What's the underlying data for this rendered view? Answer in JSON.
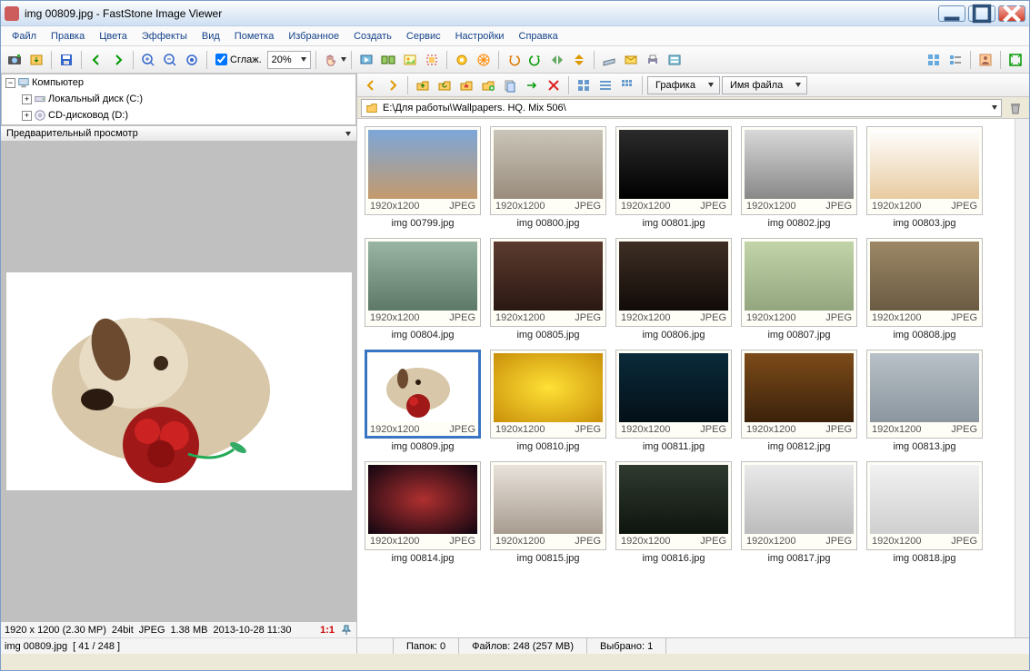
{
  "title": "img 00809.jpg  -  FastStone Image Viewer",
  "menu": [
    "Файл",
    "Правка",
    "Цвета",
    "Эффекты",
    "Вид",
    "Пометка",
    "Избранное",
    "Создать",
    "Сервис",
    "Настройки",
    "Справка"
  ],
  "toolbar1": {
    "smooth_label": "Сглаж.",
    "zoom": "20%"
  },
  "tree": {
    "root": "Компьютер",
    "children": [
      {
        "label": "Локальный диск (C:)"
      },
      {
        "label": "CD-дисковод (D:)"
      }
    ]
  },
  "preview_header": "Предварительный просмотр",
  "status_left": {
    "dims": "1920 x 1200 (2.30 MP)",
    "bits": "24bit",
    "fmt": "JPEG",
    "size": "1.38 MB",
    "date": "2013-10-28  11:30",
    "ratio": "1:1"
  },
  "status_left2": {
    "file": "img 00809.jpg",
    "pos": "[ 41 / 248 ]"
  },
  "toolbar2": {
    "view_combo": "Графика",
    "sort_combo": "Имя файла"
  },
  "path": "E:\\Для работы\\Wallpapers. HQ. Mix 506\\",
  "thumbs": [
    {
      "name": "img 00799.jpg",
      "dims": "1920x1200",
      "fmt": "JPEG",
      "bg": "linear-gradient(#7da7d9,#c49a6c)"
    },
    {
      "name": "img 00800.jpg",
      "dims": "1920x1200",
      "fmt": "JPEG",
      "bg": "linear-gradient(#c9c5b8,#9a8c7c)"
    },
    {
      "name": "img 00801.jpg",
      "dims": "1920x1200",
      "fmt": "JPEG",
      "bg": "linear-gradient(#2b2b2b,#000)"
    },
    {
      "name": "img 00802.jpg",
      "dims": "1920x1200",
      "fmt": "JPEG",
      "bg": "linear-gradient(#d8d8d8,#888)"
    },
    {
      "name": "img 00803.jpg",
      "dims": "1920x1200",
      "fmt": "JPEG",
      "bg": "linear-gradient(#fefefe,#e8cba0)"
    },
    {
      "name": "img 00804.jpg",
      "dims": "1920x1200",
      "fmt": "JPEG",
      "bg": "linear-gradient(#9ab5a3,#5e7868)"
    },
    {
      "name": "img 00805.jpg",
      "dims": "1920x1200",
      "fmt": "JPEG",
      "bg": "linear-gradient(#5c3b2e,#2b1813)"
    },
    {
      "name": "img 00806.jpg",
      "dims": "1920x1200",
      "fmt": "JPEG",
      "bg": "linear-gradient(#3e2f25,#120b08)"
    },
    {
      "name": "img 00807.jpg",
      "dims": "1920x1200",
      "fmt": "JPEG",
      "bg": "linear-gradient(#c2d4a8,#93a67f)"
    },
    {
      "name": "img 00808.jpg",
      "dims": "1920x1200",
      "fmt": "JPEG",
      "bg": "linear-gradient(#9c8866,#6b5b43)"
    },
    {
      "name": "img 00809.jpg",
      "dims": "1920x1200",
      "fmt": "JPEG",
      "bg": "linear-gradient(#fff,#f2f2f2)",
      "selected": true
    },
    {
      "name": "img 00810.jpg",
      "dims": "1920x1200",
      "fmt": "JPEG",
      "bg": "radial-gradient(#ffe135,#c98f0a)"
    },
    {
      "name": "img 00811.jpg",
      "dims": "1920x1200",
      "fmt": "JPEG",
      "bg": "linear-gradient(#0a2a3a,#041018)"
    },
    {
      "name": "img 00812.jpg",
      "dims": "1920x1200",
      "fmt": "JPEG",
      "bg": "linear-gradient(#7d4b19,#3b220b)"
    },
    {
      "name": "img 00813.jpg",
      "dims": "1920x1200",
      "fmt": "JPEG",
      "bg": "linear-gradient(#b8c1c8,#8c969e)"
    },
    {
      "name": "img 00814.jpg",
      "dims": "1920x1200",
      "fmt": "JPEG",
      "bg": "radial-gradient(#b03030,#100510)"
    },
    {
      "name": "img 00815.jpg",
      "dims": "1920x1200",
      "fmt": "JPEG",
      "bg": "linear-gradient(#e8e2da,#a89c90)"
    },
    {
      "name": "img 00816.jpg",
      "dims": "1920x1200",
      "fmt": "JPEG",
      "bg": "linear-gradient(#2f3a2f,#0f150f)"
    },
    {
      "name": "img 00817.jpg",
      "dims": "1920x1200",
      "fmt": "JPEG",
      "bg": "linear-gradient(#e9e9e9,#bcbcbc)"
    },
    {
      "name": "img 00818.jpg",
      "dims": "1920x1200",
      "fmt": "JPEG",
      "bg": "linear-gradient(#f2f2f2,#cfcfcf)"
    }
  ],
  "status_right": {
    "folders": "Папок: 0",
    "files": "Файлов: 248 (257 MB)",
    "selected": "Выбрано: 1"
  }
}
